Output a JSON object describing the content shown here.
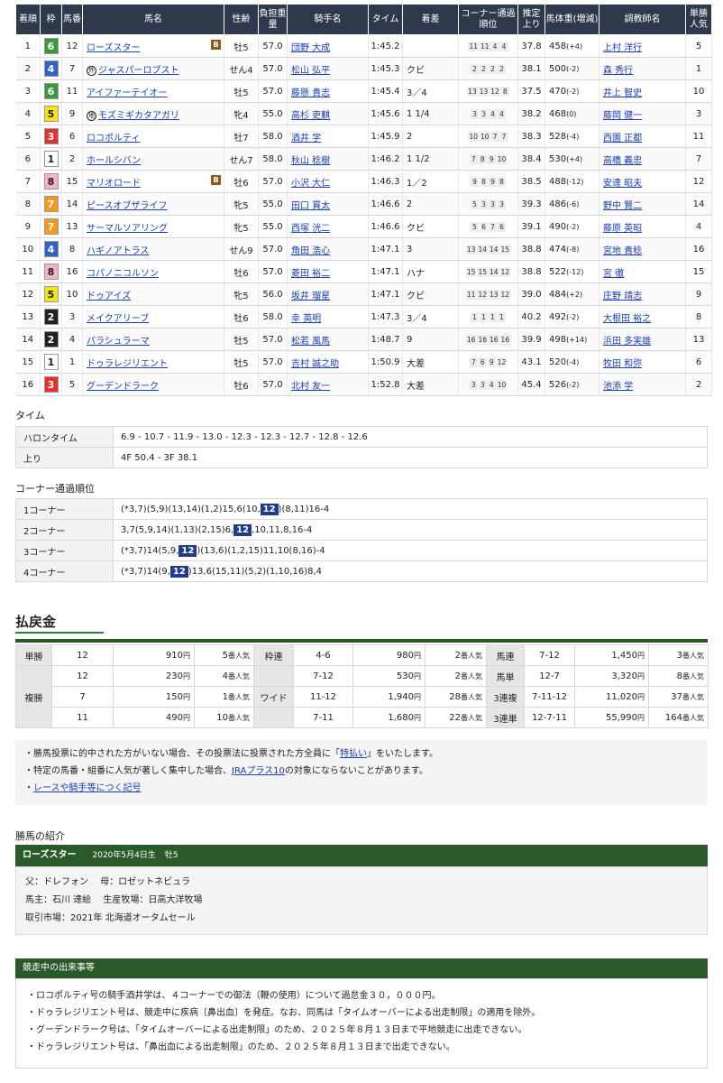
{
  "results": {
    "headers": [
      "着順",
      "枠",
      "馬番",
      "馬名",
      "性齢",
      "負担重量",
      "騎手名",
      "タイム",
      "着差",
      "コーナー通過順位",
      "推定上り",
      "馬体重(増減)",
      "調教師名",
      "単勝人気"
    ],
    "rows": [
      {
        "pos": "1",
        "waku": "6",
        "num": "12",
        "horse": "ローズスター",
        "blinker": "B",
        "mark": "",
        "sexage": "牡5",
        "weight": "57.0",
        "jockey": "団野 大成",
        "time": "1:45.2",
        "margin": "",
        "corners": [
          "11",
          "11",
          "4",
          "4"
        ],
        "last3f": "37.8",
        "bw": "458",
        "bwd": "(+4)",
        "trainer": "上村 洋行",
        "pop": "5"
      },
      {
        "pos": "2",
        "waku": "4",
        "num": "7",
        "horse": "ジャスパーロブスト",
        "blinker": "",
        "mark": "外",
        "sexage": "せん4",
        "weight": "57.0",
        "jockey": "松山 弘平",
        "time": "1:45.3",
        "margin": "クビ",
        "corners": [
          "2",
          "2",
          "2",
          "2"
        ],
        "last3f": "38.1",
        "bw": "500",
        "bwd": "(-2)",
        "trainer": "森 秀行",
        "pop": "1"
      },
      {
        "pos": "3",
        "waku": "6",
        "num": "11",
        "horse": "アイファーテイオー",
        "blinker": "",
        "mark": "",
        "sexage": "牡5",
        "weight": "57.0",
        "jockey": "藤懸 貴志",
        "time": "1:45.4",
        "margin": "3／4",
        "corners": [
          "13",
          "13",
          "12",
          "8"
        ],
        "last3f": "37.5",
        "bw": "470",
        "bwd": "(-2)",
        "trainer": "井上 智史",
        "pop": "10"
      },
      {
        "pos": "4",
        "waku": "5",
        "num": "9",
        "horse": "モズミギカタアガリ",
        "blinker": "",
        "mark": "地",
        "sexage": "牝4",
        "weight": "55.0",
        "jockey": "高杉 吏麒",
        "time": "1:45.6",
        "margin": "1 1/4",
        "corners": [
          "3",
          "3",
          "4",
          "4"
        ],
        "last3f": "38.2",
        "bw": "468",
        "bwd": "(0)",
        "trainer": "藤岡 健一",
        "pop": "3"
      },
      {
        "pos": "5",
        "waku": "3",
        "num": "6",
        "horse": "ロコポルティ",
        "blinker": "",
        "mark": "",
        "sexage": "牡7",
        "weight": "58.0",
        "jockey": "酒井 学",
        "time": "1:45.9",
        "margin": "2",
        "corners": [
          "10",
          "10",
          "7",
          "7"
        ],
        "last3f": "38.3",
        "bw": "528",
        "bwd": "(-4)",
        "trainer": "西園 正都",
        "pop": "11"
      },
      {
        "pos": "6",
        "waku": "1",
        "num": "2",
        "horse": "ホールシバン",
        "blinker": "",
        "mark": "",
        "sexage": "せん7",
        "weight": "58.0",
        "jockey": "秋山 稔樹",
        "time": "1:46.2",
        "margin": "1 1/2",
        "corners": [
          "7",
          "8",
          "9",
          "10"
        ],
        "last3f": "38.4",
        "bw": "530",
        "bwd": "(+4)",
        "trainer": "高橋 義忠",
        "pop": "7"
      },
      {
        "pos": "7",
        "waku": "8",
        "num": "15",
        "horse": "マリオロード",
        "blinker": "B",
        "mark": "",
        "sexage": "牡6",
        "weight": "57.0",
        "jockey": "小沢 大仁",
        "time": "1:46.3",
        "margin": "1／2",
        "corners": [
          "9",
          "8",
          "9",
          "8"
        ],
        "last3f": "38.5",
        "bw": "488",
        "bwd": "(-12)",
        "trainer": "安達 昭夫",
        "pop": "12"
      },
      {
        "pos": "8",
        "waku": "7",
        "num": "14",
        "horse": "ピースオブザライフ",
        "blinker": "",
        "mark": "",
        "sexage": "牝5",
        "weight": "55.0",
        "jockey": "田口 貫太",
        "time": "1:46.6",
        "margin": "2",
        "corners": [
          "5",
          "3",
          "3",
          "3"
        ],
        "last3f": "39.3",
        "bw": "486",
        "bwd": "(-6)",
        "trainer": "野中 賢二",
        "pop": "14"
      },
      {
        "pos": "9",
        "waku": "7",
        "num": "13",
        "horse": "サーマルソアリング",
        "blinker": "",
        "mark": "",
        "sexage": "牝5",
        "weight": "55.0",
        "jockey": "西塚 洸二",
        "time": "1:46.6",
        "margin": "クビ",
        "corners": [
          "5",
          "6",
          "7",
          "6"
        ],
        "last3f": "39.1",
        "bw": "490",
        "bwd": "(-2)",
        "trainer": "藤原 英昭",
        "pop": "4"
      },
      {
        "pos": "10",
        "waku": "4",
        "num": "8",
        "horse": "ハギノアトラス",
        "blinker": "",
        "mark": "",
        "sexage": "せん9",
        "weight": "57.0",
        "jockey": "角田 浩心",
        "time": "1:47.1",
        "margin": "3",
        "corners": [
          "13",
          "14",
          "14",
          "15"
        ],
        "last3f": "38.8",
        "bw": "474",
        "bwd": "(-8)",
        "trainer": "宮地 貴稔",
        "pop": "16"
      },
      {
        "pos": "11",
        "waku": "8",
        "num": "16",
        "horse": "コパノニコルソン",
        "blinker": "",
        "mark": "",
        "sexage": "牡6",
        "weight": "57.0",
        "jockey": "菱田 裕二",
        "time": "1:47.1",
        "margin": "ハナ",
        "corners": [
          "15",
          "15",
          "14",
          "12"
        ],
        "last3f": "38.8",
        "bw": "522",
        "bwd": "(-12)",
        "trainer": "宮 徹",
        "pop": "15"
      },
      {
        "pos": "12",
        "waku": "5",
        "num": "10",
        "horse": "ドゥアイズ",
        "blinker": "",
        "mark": "",
        "sexage": "牝5",
        "weight": "56.0",
        "jockey": "坂井 瑠星",
        "time": "1:47.1",
        "margin": "クビ",
        "corners": [
          "11",
          "12",
          "13",
          "12"
        ],
        "last3f": "39.0",
        "bw": "484",
        "bwd": "(+2)",
        "trainer": "庄野 靖志",
        "pop": "9"
      },
      {
        "pos": "13",
        "waku": "2",
        "num": "3",
        "horse": "メイクアリーブ",
        "blinker": "",
        "mark": "",
        "sexage": "牡6",
        "weight": "58.0",
        "jockey": "幸 英明",
        "time": "1:47.3",
        "margin": "3／4",
        "corners": [
          "1",
          "1",
          "1",
          "1"
        ],
        "last3f": "40.2",
        "bw": "492",
        "bwd": "(-2)",
        "trainer": "大根田 裕之",
        "pop": "8"
      },
      {
        "pos": "14",
        "waku": "2",
        "num": "4",
        "horse": "パラシュラーマ",
        "blinker": "",
        "mark": "",
        "sexage": "牡5",
        "weight": "57.0",
        "jockey": "松若 風馬",
        "time": "1:48.7",
        "margin": "9",
        "corners": [
          "16",
          "16",
          "16",
          "16"
        ],
        "last3f": "39.9",
        "bw": "498",
        "bwd": "(+14)",
        "trainer": "浜田 多実雄",
        "pop": "13"
      },
      {
        "pos": "15",
        "waku": "1",
        "num": "1",
        "horse": "ドゥラレジリエント",
        "blinker": "",
        "mark": "",
        "sexage": "牡5",
        "weight": "57.0",
        "jockey": "吉村 誠之助",
        "time": "1:50.9",
        "margin": "大差",
        "corners": [
          "7",
          "6",
          "9",
          "12"
        ],
        "last3f": "43.1",
        "bw": "520",
        "bwd": "(-4)",
        "trainer": "牧田 和弥",
        "pop": "6"
      },
      {
        "pos": "16",
        "waku": "3",
        "num": "5",
        "horse": "グーデンドラーク",
        "blinker": "",
        "mark": "",
        "sexage": "牡6",
        "weight": "57.0",
        "jockey": "北村 友一",
        "time": "1:52.8",
        "margin": "大差",
        "corners": [
          "3",
          "3",
          "4",
          "10"
        ],
        "last3f": "45.4",
        "bw": "526",
        "bwd": "(-2)",
        "trainer": "池添 学",
        "pop": "2"
      }
    ]
  },
  "waku_colors": {
    "1": {
      "bg": "#ffffff",
      "fg": "#222222"
    },
    "2": {
      "bg": "#222222",
      "fg": "#ffffff"
    },
    "3": {
      "bg": "#e0322e",
      "fg": "#ffffff"
    },
    "4": {
      "bg": "#2f62c6",
      "fg": "#ffffff"
    },
    "5": {
      "bg": "#f3e21c",
      "fg": "#222222"
    },
    "6": {
      "bg": "#3a9a3a",
      "fg": "#ffffff"
    },
    "7": {
      "bg": "#f39a1e",
      "fg": "#ffffff"
    },
    "8": {
      "bg": "#f6b3c8",
      "fg": "#222222"
    }
  },
  "time_section": {
    "heading": "タイム",
    "halon_label": "ハロンタイム",
    "halon_value": "6.9 - 10.7 - 11.9 - 13.0 - 12.3 - 12.3 - 12.7 - 12.8 - 12.6",
    "agari_label": "上り",
    "agari_value": "4F 50.4 - 3F 38.1"
  },
  "corner_section": {
    "heading": "コーナー通過順位",
    "rows": [
      {
        "label": "1コーナー",
        "pre": "(*3,7)(5,9)(13,14)(1,2)15,6(10,",
        "hl": "12",
        "post": ")(8,11)16-4"
      },
      {
        "label": "2コーナー",
        "pre": "3,7(5,9,14)(1,13)(2,15)6,",
        "hl": "12",
        "post": ",10,11,8,16-4"
      },
      {
        "label": "3コーナー",
        "pre": "(*3,7)14(5,9,",
        "hl": "12",
        "post": ")(13,6)(1,2,15)11,10(8,16)-4"
      },
      {
        "label": "4コーナー",
        "pre": "(*3,7)14(9,",
        "hl": "12",
        "post": ")13,6(15,11)(5,2)(1,10,16)8,4"
      }
    ]
  },
  "payout": {
    "title": "払戻金",
    "labels": {
      "tansho": "単勝",
      "fukusho": "複勝",
      "wakuren": "枠連",
      "wide": "ワイド",
      "umaren": "馬連",
      "umatan": "馬単",
      "sanrenpuku": "3連複",
      "sanrentan": "3連単"
    },
    "yen": "円",
    "ninki": "番人気",
    "tansho": [
      {
        "num": "12",
        "pay": "910",
        "pop": "5"
      }
    ],
    "fukusho": [
      {
        "num": "12",
        "pay": "230",
        "pop": "4"
      },
      {
        "num": "7",
        "pay": "150",
        "pop": "1"
      },
      {
        "num": "11",
        "pay": "490",
        "pop": "10"
      }
    ],
    "wakuren": [
      {
        "num": "4-6",
        "pay": "980",
        "pop": "2"
      }
    ],
    "wide": [
      {
        "num": "7-12",
        "pay": "530",
        "pop": "2"
      },
      {
        "num": "11-12",
        "pay": "1,940",
        "pop": "28"
      },
      {
        "num": "7-11",
        "pay": "1,680",
        "pop": "22"
      }
    ],
    "umaren": [
      {
        "num": "7-12",
        "pay": "1,450",
        "pop": "3"
      }
    ],
    "umatan": [
      {
        "num": "12-7",
        "pay": "3,320",
        "pop": "8"
      }
    ],
    "sanrenpuku": [
      {
        "num": "7-11-12",
        "pay": "11,020",
        "pop": "37"
      }
    ],
    "sanrentan": [
      {
        "num": "12-7-11",
        "pay": "55,990",
        "pop": "164"
      }
    ]
  },
  "notes": {
    "n1_pre": "勝馬投票に的中された方がいない場合、その投票法に投票された方全員に「",
    "n1_link": "特払い",
    "n1_post": "」をいたします。",
    "n2_pre": "特定の馬番・組番に人気が著しく集中した場合、",
    "n2_link": "JRAプラス10",
    "n2_post": "の対象にならないことがあります。",
    "n3_link": "レースや騎手等につく記号"
  },
  "intro": {
    "heading": "勝馬の紹介",
    "name": "ローズスター",
    "birth": "2020年5月4日生",
    "sexage": "牡5",
    "line1": "父：ドレフォン　 母：ロゼットネビュラ",
    "line2": "馬主：石川 達絵　 生産牧場：日高大洋牧場",
    "line3": "取引市場：2021年 北海道オータムセール"
  },
  "incidents": {
    "title": "競走中の出来事等",
    "items": [
      "ロコポルティ号の騎手酒井学は、４コーナーでの御法（鞭の使用）について過怠金３０，０００円。",
      "ドゥラレジリエント号は、競走中に疾病〔鼻出血〕を発症。なお、同馬は「タイムオーバーによる出走制限」の適用を除外。",
      "グーデンドラーク号は、「タイムオーバーによる出走制限」のため、２０２５年８月１３日まで平地競走に出走できない。",
      "ドゥラレジリエント号は、「鼻出血による出走制限」のため、２０２５年８月１３日まで出走できない。"
    ]
  }
}
